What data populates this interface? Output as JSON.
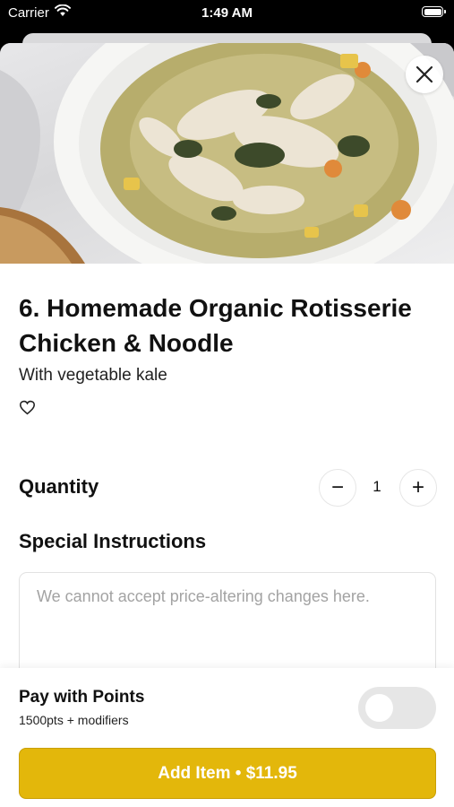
{
  "status_bar": {
    "carrier": "Carrier",
    "time": "1:49 AM"
  },
  "item": {
    "title": "6. Homemade Organic Rotisserie Chicken & Noodle",
    "description": "With vegetable kale"
  },
  "quantity": {
    "label": "Quantity",
    "value": "1",
    "minus_symbol": "−",
    "plus_symbol": "+"
  },
  "instructions": {
    "label": "Special Instructions",
    "placeholder": "We cannot accept price-altering changes here."
  },
  "points": {
    "title": "Pay with Points",
    "subtitle": "1500pts + modifiers",
    "toggle_on": false
  },
  "add_button": {
    "label": "Add Item • $11.95"
  },
  "colors": {
    "accent": "#e3b70b"
  },
  "icons": {
    "close": "close-icon",
    "favorite": "heart-icon",
    "wifi": "wifi-icon",
    "battery": "battery-icon"
  }
}
